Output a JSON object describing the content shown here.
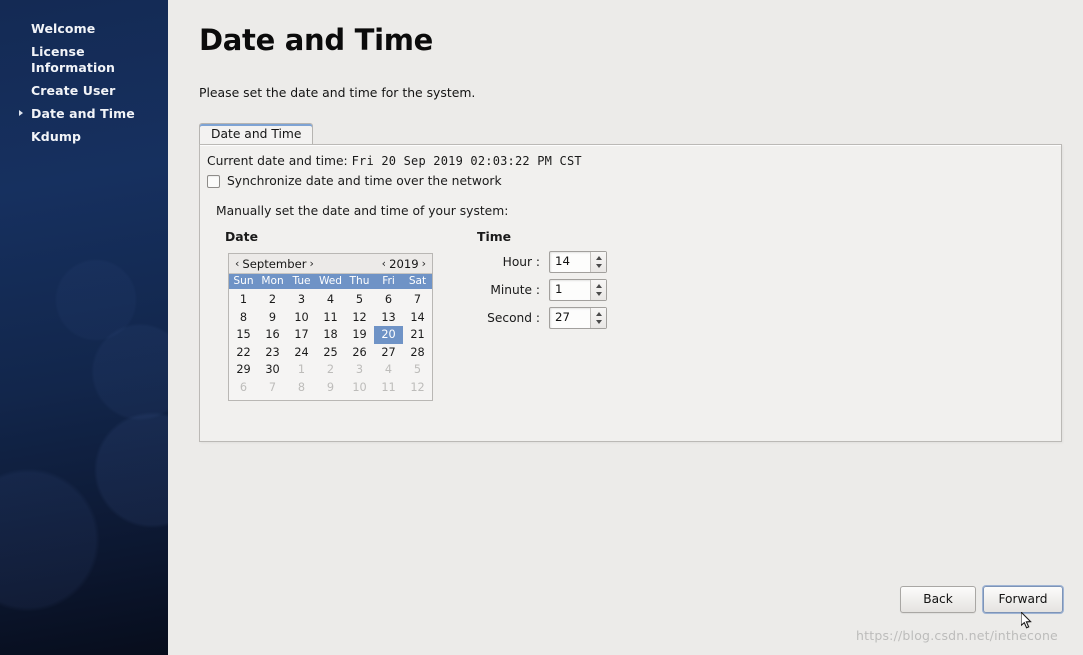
{
  "sidebar": {
    "items": [
      {
        "label": "Welcome",
        "active": false
      },
      {
        "label": "License Information",
        "active": false
      },
      {
        "label": "Create User",
        "active": false
      },
      {
        "label": "Date and Time",
        "active": true
      },
      {
        "label": "Kdump",
        "active": false
      }
    ]
  },
  "page": {
    "title": "Date and Time",
    "description": "Please set the date and time for the system."
  },
  "tabs": [
    {
      "label": "Date and Time",
      "selected": true
    }
  ],
  "panel": {
    "current_label": "Current date and time:",
    "current_value": "Fri 20 Sep 2019 02:03:22 PM CST",
    "sync_checkbox_label": "Synchronize date and time over the network",
    "sync_checked": false,
    "manual_label": "Manually set the date and time of your system:",
    "date_heading": "Date",
    "time_heading": "Time"
  },
  "calendar": {
    "prev_month_arrow": "‹",
    "month": "September",
    "next_month_arrow": "›",
    "prev_year_arrow": "‹",
    "year": "2019",
    "next_year_arrow": "›",
    "weekdays": [
      "Sun",
      "Mon",
      "Tue",
      "Wed",
      "Thu",
      "Fri",
      "Sat"
    ],
    "selected_day": 20,
    "header_color": "#6f93c6",
    "days": [
      {
        "n": "1",
        "muted": false
      },
      {
        "n": "2",
        "muted": false
      },
      {
        "n": "3",
        "muted": false
      },
      {
        "n": "4",
        "muted": false
      },
      {
        "n": "5",
        "muted": false
      },
      {
        "n": "6",
        "muted": false
      },
      {
        "n": "7",
        "muted": false
      },
      {
        "n": "8",
        "muted": false
      },
      {
        "n": "9",
        "muted": false
      },
      {
        "n": "10",
        "muted": false
      },
      {
        "n": "11",
        "muted": false
      },
      {
        "n": "12",
        "muted": false
      },
      {
        "n": "13",
        "muted": false
      },
      {
        "n": "14",
        "muted": false
      },
      {
        "n": "15",
        "muted": false
      },
      {
        "n": "16",
        "muted": false
      },
      {
        "n": "17",
        "muted": false
      },
      {
        "n": "18",
        "muted": false
      },
      {
        "n": "19",
        "muted": false
      },
      {
        "n": "20",
        "muted": false,
        "selected": true
      },
      {
        "n": "21",
        "muted": false
      },
      {
        "n": "22",
        "muted": false
      },
      {
        "n": "23",
        "muted": false
      },
      {
        "n": "24",
        "muted": false
      },
      {
        "n": "25",
        "muted": false
      },
      {
        "n": "26",
        "muted": false
      },
      {
        "n": "27",
        "muted": false
      },
      {
        "n": "28",
        "muted": false
      },
      {
        "n": "29",
        "muted": false
      },
      {
        "n": "30",
        "muted": false
      },
      {
        "n": "1",
        "muted": true
      },
      {
        "n": "2",
        "muted": true
      },
      {
        "n": "3",
        "muted": true
      },
      {
        "n": "4",
        "muted": true
      },
      {
        "n": "5",
        "muted": true
      },
      {
        "n": "6",
        "muted": true
      },
      {
        "n": "7",
        "muted": true
      },
      {
        "n": "8",
        "muted": true
      },
      {
        "n": "9",
        "muted": true
      },
      {
        "n": "10",
        "muted": true
      },
      {
        "n": "11",
        "muted": true
      },
      {
        "n": "12",
        "muted": true
      }
    ]
  },
  "time": {
    "fields": [
      {
        "label": "Hour :",
        "value": "14"
      },
      {
        "label": "Minute :",
        "value": "1"
      },
      {
        "label": "Second :",
        "value": "27"
      }
    ]
  },
  "footer": {
    "back_label": "Back",
    "forward_label": "Forward"
  },
  "watermark": "https://blog.csdn.net/inthecone"
}
